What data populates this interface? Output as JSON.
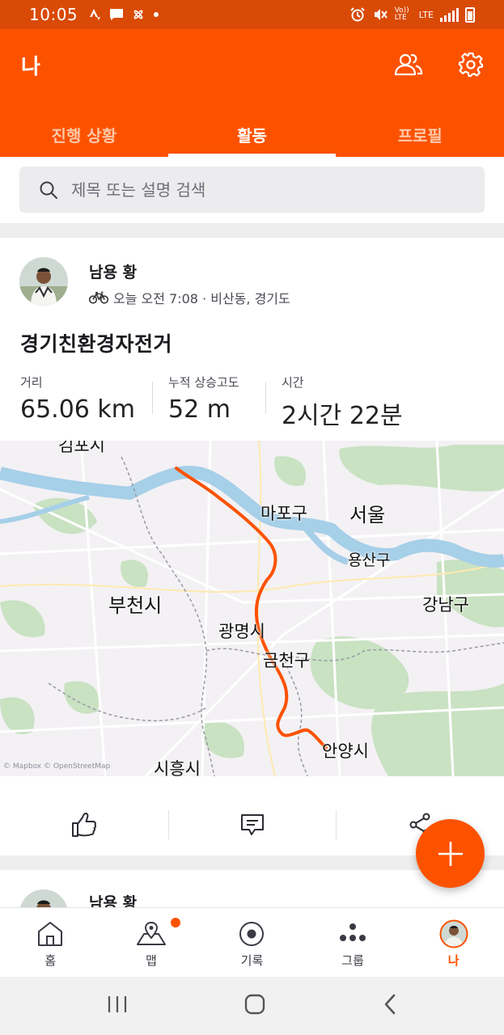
{
  "status_bar": {
    "time": "10:05",
    "network": "LTE",
    "volte": "Vo)) LTE"
  },
  "app_bar": {
    "title": "나",
    "tabs": [
      {
        "label": "진행 상황",
        "active": false
      },
      {
        "label": "활동",
        "active": true
      },
      {
        "label": "프로필",
        "active": false
      }
    ]
  },
  "search": {
    "placeholder": "제목 또는 설명 검색"
  },
  "activity": {
    "athlete_name": "남용 황",
    "meta": "오늘 오전 7:08 · 비산동, 경기도",
    "title": "경기친환경자전거",
    "stats": [
      {
        "label": "거리",
        "value": "65.06 km"
      },
      {
        "label": "누적 상승고도",
        "value": "52 m"
      },
      {
        "label": "시간",
        "value": "2시간 22분"
      }
    ],
    "map": {
      "labels": {
        "gimpo": "김포시",
        "mapo": "마포구",
        "seoul": "서울",
        "yongsan": "용산구",
        "bucheon": "부천시",
        "gangnam": "강남구",
        "gwangmyeong": "광명시",
        "geumcheon": "금천구",
        "anyang": "안양시",
        "siheung": "시흥시"
      },
      "attribution": "© Mapbox © OpenStreetMap",
      "route_color": "#fc5200"
    }
  },
  "next_activity": {
    "athlete_name": "남용 황"
  },
  "bottom_nav": [
    {
      "label": "홈",
      "icon": "home-icon",
      "active": false
    },
    {
      "label": "맵",
      "icon": "map-icon",
      "active": false
    },
    {
      "label": "기록",
      "icon": "record-icon",
      "active": false
    },
    {
      "label": "그룹",
      "icon": "groups-icon",
      "active": false
    },
    {
      "label": "나",
      "icon": "profile-avatar",
      "active": true
    }
  ],
  "colors": {
    "brand": "#fc5200",
    "status_bar": "#d94a06"
  }
}
